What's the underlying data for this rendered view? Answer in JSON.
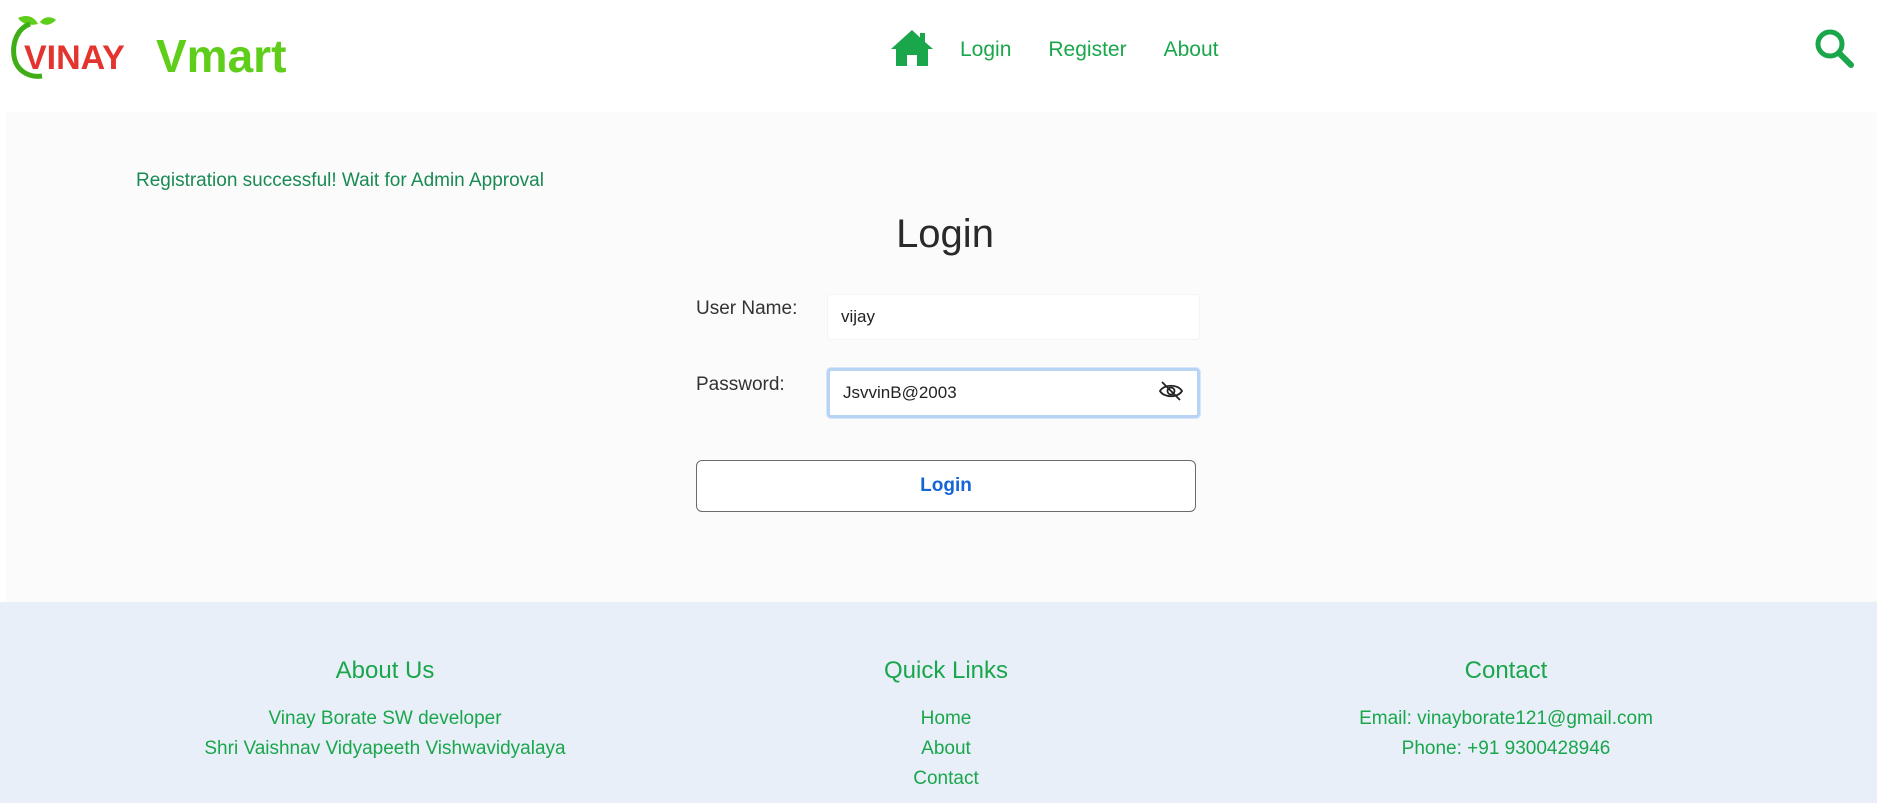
{
  "brand": {
    "logo_text_part1": "VINAY",
    "logo_text_part2": "Vmart",
    "primary_color": "#1aa64b",
    "accent_red": "#e3342f",
    "accent_lime": "#5fce1b"
  },
  "nav": {
    "home_icon": "home-icon",
    "links": [
      "Login",
      "Register",
      "About"
    ],
    "search_icon": "search-icon"
  },
  "flash": {
    "message": "Registration successful! Wait for Admin Approval"
  },
  "login_form": {
    "title": "Login",
    "username_label": "User Name:",
    "username_value": "vijay",
    "password_label": "Password:",
    "password_value": "JsvvinB@2003",
    "toggle_icon": "eye-off-icon",
    "submit_label": "Login"
  },
  "footer": {
    "about": {
      "heading": "About Us",
      "lines": [
        "Vinay Borate SW developer",
        "Shri Vaishnav Vidyapeeth Vishwavidyalaya"
      ]
    },
    "quick_links": {
      "heading": "Quick Links",
      "links": [
        "Home",
        "About",
        "Contact"
      ]
    },
    "contact": {
      "heading": "Contact",
      "lines": [
        "Email: vinayborate121@gmail.com",
        "Phone: +91 9300428946"
      ]
    }
  }
}
